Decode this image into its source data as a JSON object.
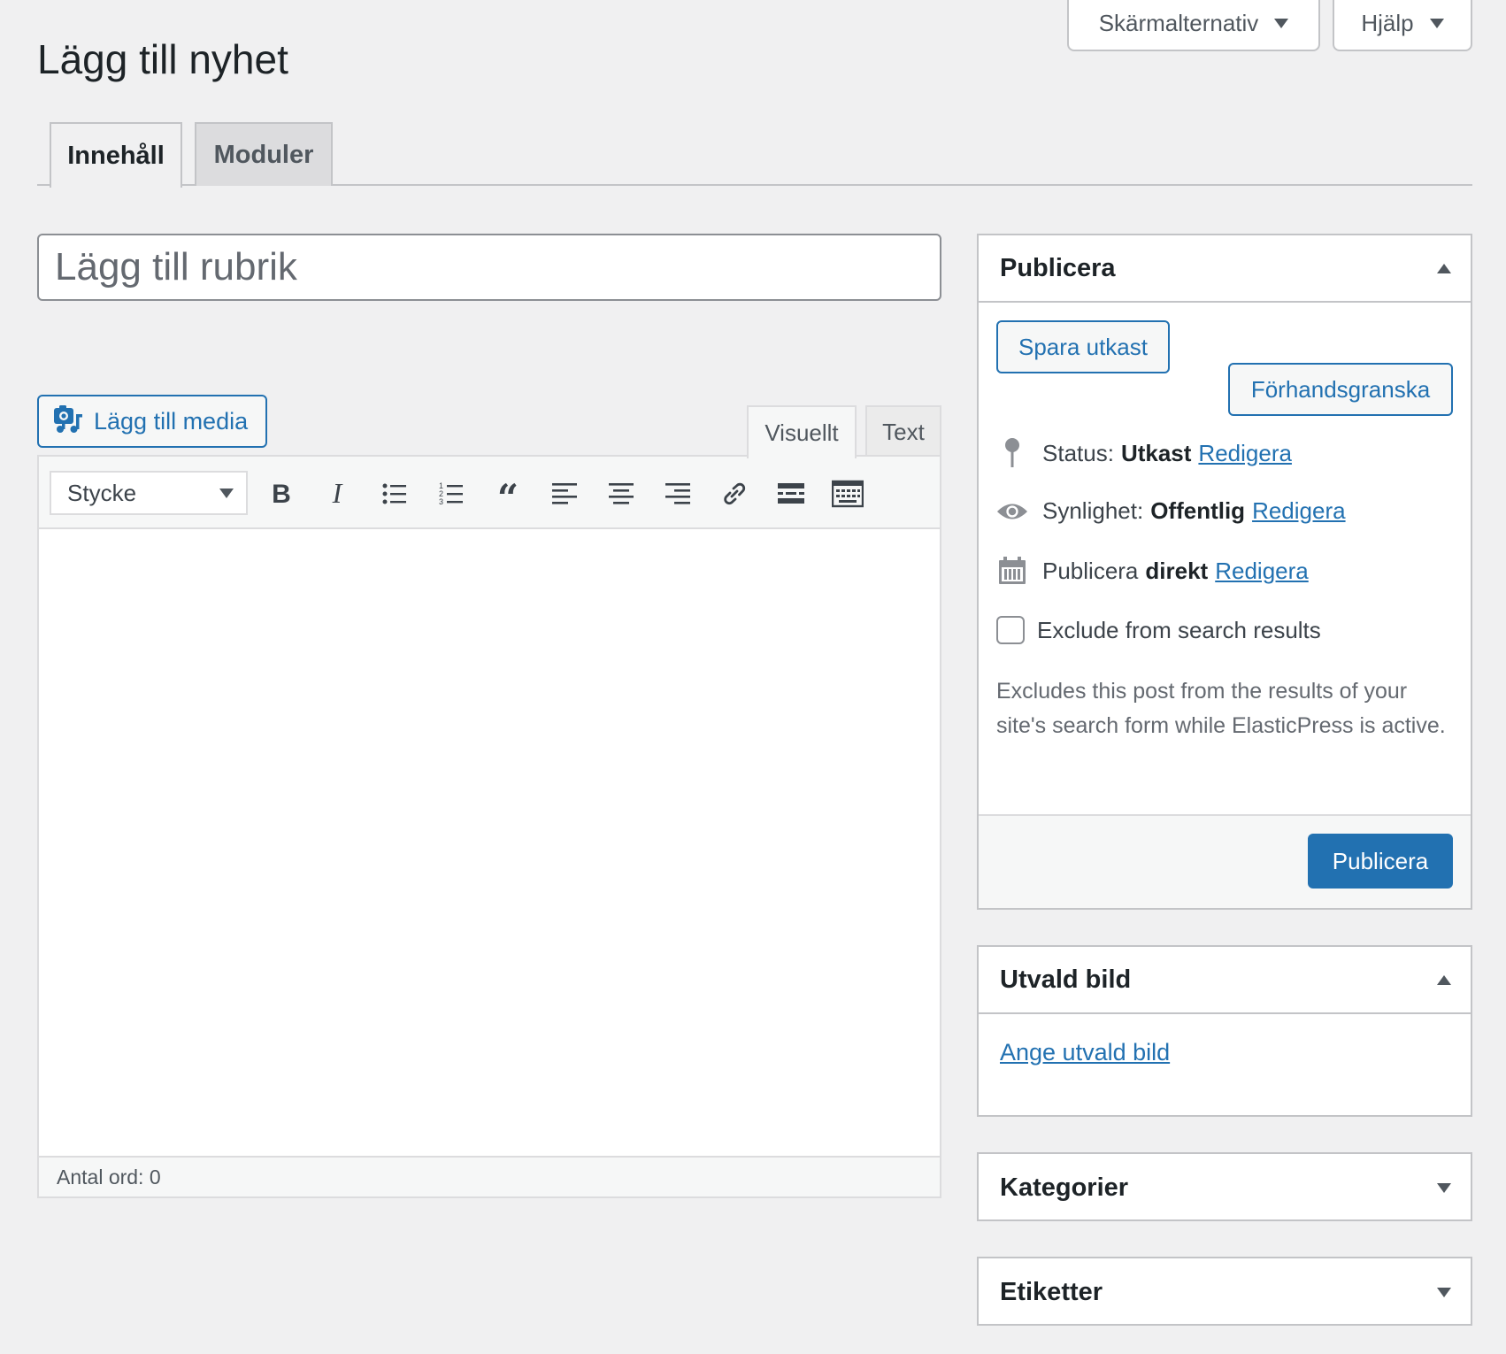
{
  "screen_meta": {
    "screen_options_label": "Skärmalternativ",
    "help_label": "Hjälp"
  },
  "page_title": "Lägg till nyhet",
  "tabs": [
    {
      "label": "Innehåll"
    },
    {
      "label": "Moduler"
    }
  ],
  "title_field": {
    "placeholder": "Lägg till rubrik",
    "value": ""
  },
  "editor": {
    "add_media_label": "Lägg till media",
    "mode_tabs": [
      {
        "label": "Visuellt"
      },
      {
        "label": "Text"
      }
    ],
    "format_select": {
      "value": "Stycke"
    },
    "word_count": "Antal ord: 0",
    "toolbar_icons": [
      "bold-icon",
      "italic-icon",
      "bulleted-list-icon",
      "numbered-list-icon",
      "blockquote-icon",
      "align-left-icon",
      "align-center-icon",
      "align-right-icon",
      "link-icon",
      "read-more-icon",
      "toolbar-toggle-icon"
    ]
  },
  "publish_box": {
    "title": "Publicera",
    "save_draft_label": "Spara utkast",
    "preview_label": "Förhandsgranska",
    "status": {
      "label": "Status:",
      "value": "Utkast",
      "edit_label": "Redigera"
    },
    "visibility": {
      "label": "Synlighet:",
      "value": "Offentlig",
      "edit_label": "Redigera"
    },
    "schedule": {
      "label": "Publicera",
      "value": "direkt",
      "edit_label": "Redigera"
    },
    "exclude_search": {
      "label": "Exclude from search results",
      "checked": false
    },
    "exclude_description": "Excludes this post from the results of your site's search form while ElasticPress is active.",
    "publish_label": "Publicera"
  },
  "featured_image_box": {
    "title": "Utvald bild",
    "link_label": "Ange utvald bild"
  },
  "categories_box": {
    "title": "Kategorier"
  },
  "tags_box": {
    "title": "Etiketter"
  },
  "colors": {
    "accent": "#2271b1",
    "background": "#f0f0f1",
    "border": "#c3c4c7"
  }
}
